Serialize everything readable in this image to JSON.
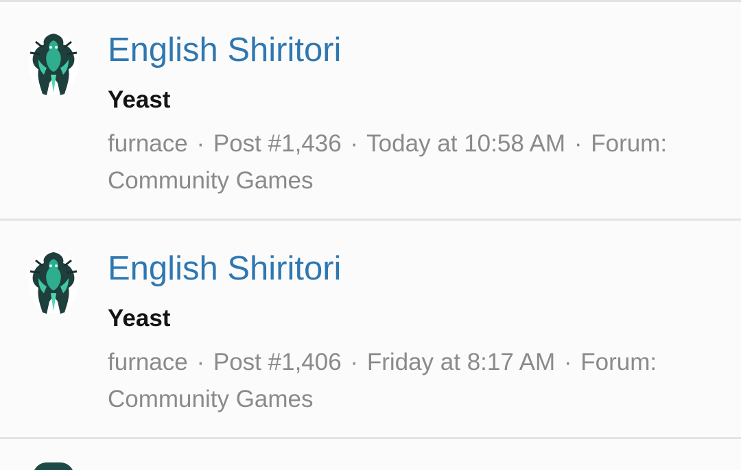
{
  "results": [
    {
      "thread_title": "English Shiritori",
      "snippet": "Yeast",
      "author": "furnace",
      "post_number": "Post #1,436",
      "time": "Today at 10:58 AM",
      "forum_label": "Forum:",
      "forum_name": "Community Games",
      "separator": "·"
    },
    {
      "thread_title": "English Shiritori",
      "snippet": "Yeast",
      "author": "furnace",
      "post_number": "Post #1,406",
      "time": "Friday at 8:17 AM",
      "forum_label": "Forum:",
      "forum_name": "Community Games",
      "separator": "·"
    }
  ],
  "colors": {
    "link": "#2f77b1",
    "meta": "#8a8a8a",
    "snippet": "#141414",
    "divider": "#e3e3e3"
  },
  "icons": {
    "avatar": "avatar-icon"
  }
}
